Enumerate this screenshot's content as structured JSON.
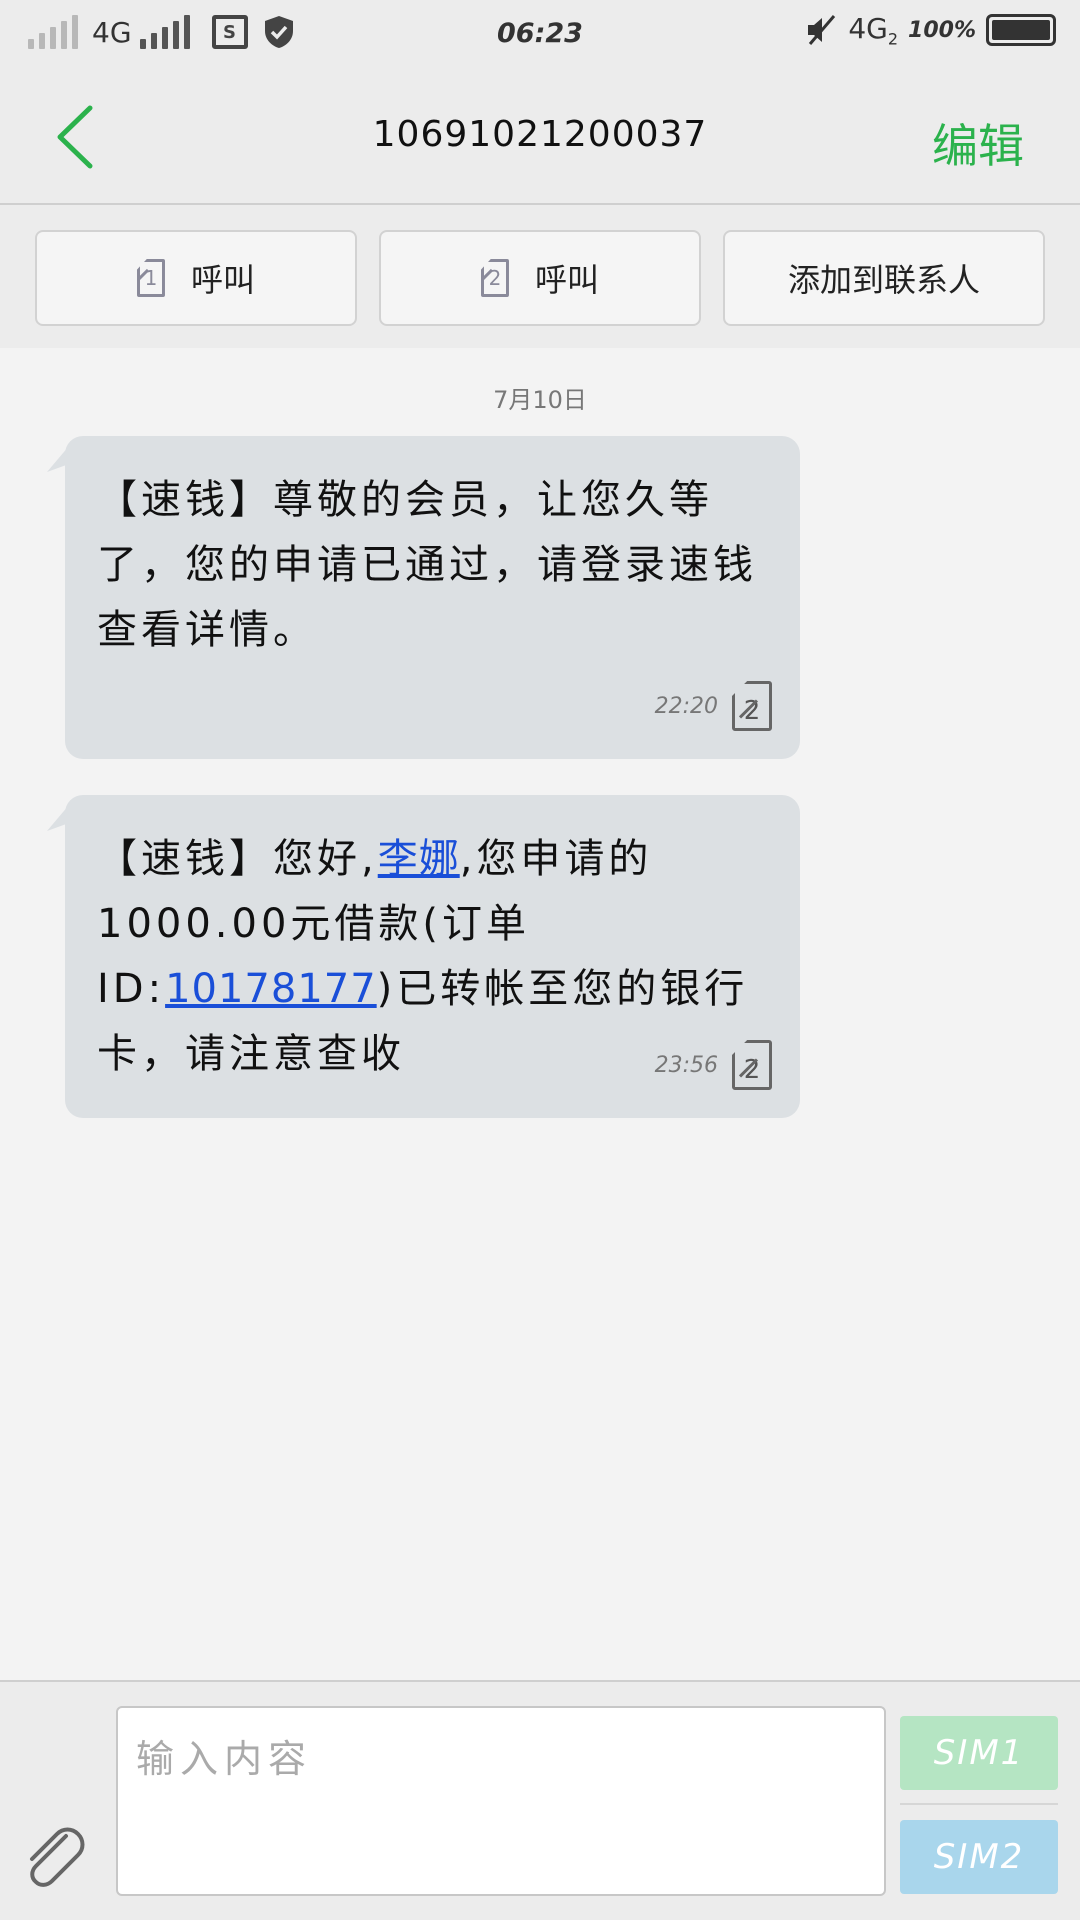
{
  "status_bar": {
    "network_1": "4G",
    "network_2": "4G",
    "network_2_suffix": "2",
    "sd_label": "S",
    "time": "06:23",
    "battery": "100%"
  },
  "header": {
    "title": "10691021200037",
    "edit_label": "编辑"
  },
  "actions": [
    {
      "label": "呼叫",
      "sim": "1"
    },
    {
      "label": "呼叫",
      "sim": "2"
    },
    {
      "label": "添加到联系人"
    }
  ],
  "conversation": {
    "date": "7月10日",
    "messages": [
      {
        "text": "【速钱】尊敬的会员，让您久等了，您的申请已通过，请登录速钱查看详情。",
        "time": "22:20",
        "sim": "2"
      },
      {
        "text_before": "【速钱】您好,",
        "name_link": "李娜",
        "text_mid": ",您申请的1000.00元借款(订单ID:",
        "order_link": "10178177",
        "text_after": ")已转帐至您的银行卡，请注意查收",
        "time": "23:56",
        "sim": "2"
      }
    ]
  },
  "composer": {
    "placeholder": "输入内容",
    "value": "",
    "sim1_label": "SIM1",
    "sim2_label": "SIM2"
  },
  "colors": {
    "accent_green": "#2bb24c",
    "link_blue": "#1a4fd8",
    "bubble": "#dce0e3",
    "sim1_button": "#b5e5c3",
    "sim2_button": "#a9d6ec"
  }
}
